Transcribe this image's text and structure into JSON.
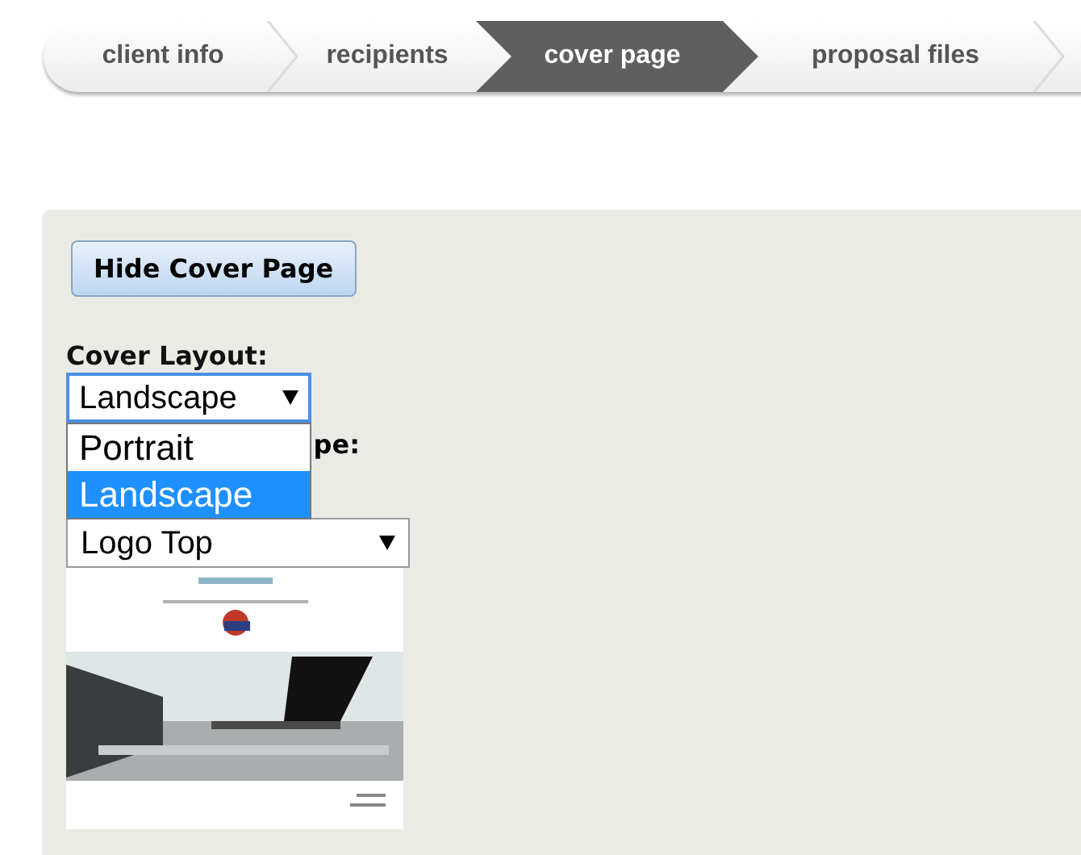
{
  "steps": [
    {
      "label": "client info",
      "selected": false
    },
    {
      "label": "recipients",
      "selected": false
    },
    {
      "label": "cover page",
      "selected": true
    },
    {
      "label": "proposal files",
      "selected": false
    }
  ],
  "hide_button": "Hide Cover Page",
  "layout_label": "Cover Layout:",
  "layout_select": {
    "value": "Landscape",
    "expanded": true,
    "options": [
      {
        "label": "Portrait",
        "selected": false
      },
      {
        "label": "Landscape",
        "selected": true
      }
    ]
  },
  "type_label_visible": "pe:",
  "type_select": {
    "value": "Logo Top"
  }
}
